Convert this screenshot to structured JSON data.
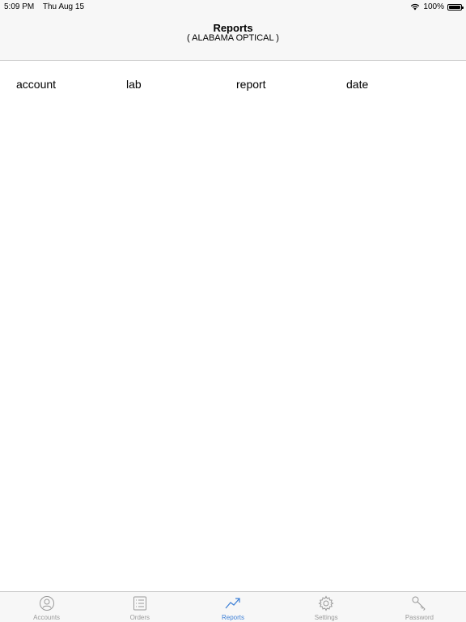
{
  "status_bar": {
    "time": "5:09 PM",
    "date": "Thu Aug 15",
    "battery": "100%"
  },
  "nav": {
    "title": "Reports",
    "subtitle": "( ALABAMA OPTICAL )"
  },
  "table": {
    "columns": [
      "account",
      "lab",
      "report",
      "date"
    ]
  },
  "tabs": [
    {
      "label": "Accounts",
      "icon": "person-circle-icon",
      "active": false
    },
    {
      "label": "Orders",
      "icon": "list-icon",
      "active": false
    },
    {
      "label": "Reports",
      "icon": "trending-up-icon",
      "active": true
    },
    {
      "label": "Settings",
      "icon": "gear-icon",
      "active": false
    },
    {
      "label": "Password",
      "icon": "key-icon",
      "active": false
    }
  ],
  "colors": {
    "active_tab": "#3c7fd6",
    "inactive_tab": "#9a9a9a",
    "bar_background": "#f7f7f7"
  }
}
